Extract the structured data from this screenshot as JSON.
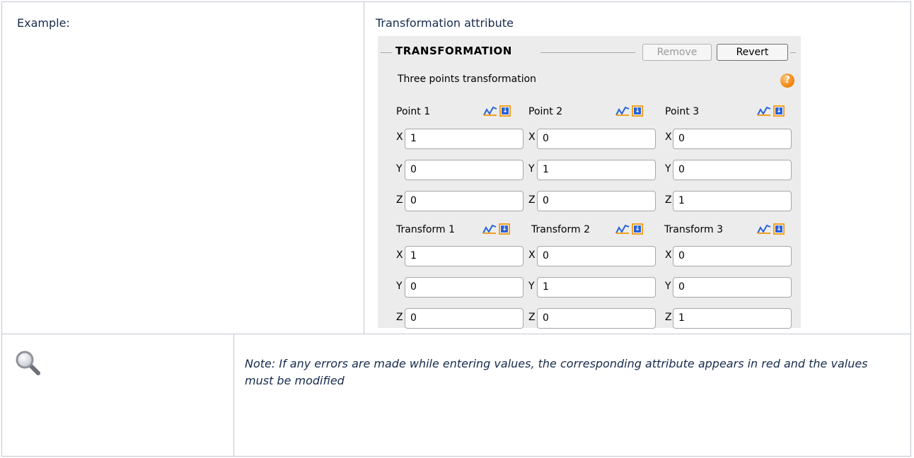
{
  "doc": {
    "example_label": "Example:",
    "attribute_title": "Transformation attribute",
    "note": "Note: If any errors are made while entering values, the corresponding attribute appears in red and the values must be modified",
    "note_icon": "magnifier-icon"
  },
  "panel": {
    "title": "TRANSFORMATION",
    "remove_label": "Remove",
    "revert_label": "Revert",
    "subtitle": "Three points transformation",
    "help_icon": "?",
    "colors": {
      "help": "#f28a12",
      "pick_border": "#f0a020",
      "pick_fill": "#2a62d8",
      "graph": "#2a62d8"
    },
    "groups": {
      "point1": {
        "label": "Point 1",
        "x": "1",
        "y": "0",
        "z": "0"
      },
      "point2": {
        "label": "Point 2",
        "x": "0",
        "y": "1",
        "z": "0"
      },
      "point3": {
        "label": "Point 3",
        "x": "0",
        "y": "0",
        "z": "1"
      },
      "transform1": {
        "label": "Transform 1",
        "x": "1",
        "y": "0",
        "z": "0"
      },
      "transform2": {
        "label": "Transform 2",
        "x": "0",
        "y": "1",
        "z": "0"
      },
      "transform3": {
        "label": "Transform 3",
        "x": "0",
        "y": "0",
        "z": "1"
      }
    },
    "axis": {
      "x": "X",
      "y": "Y",
      "z": "Z"
    }
  }
}
